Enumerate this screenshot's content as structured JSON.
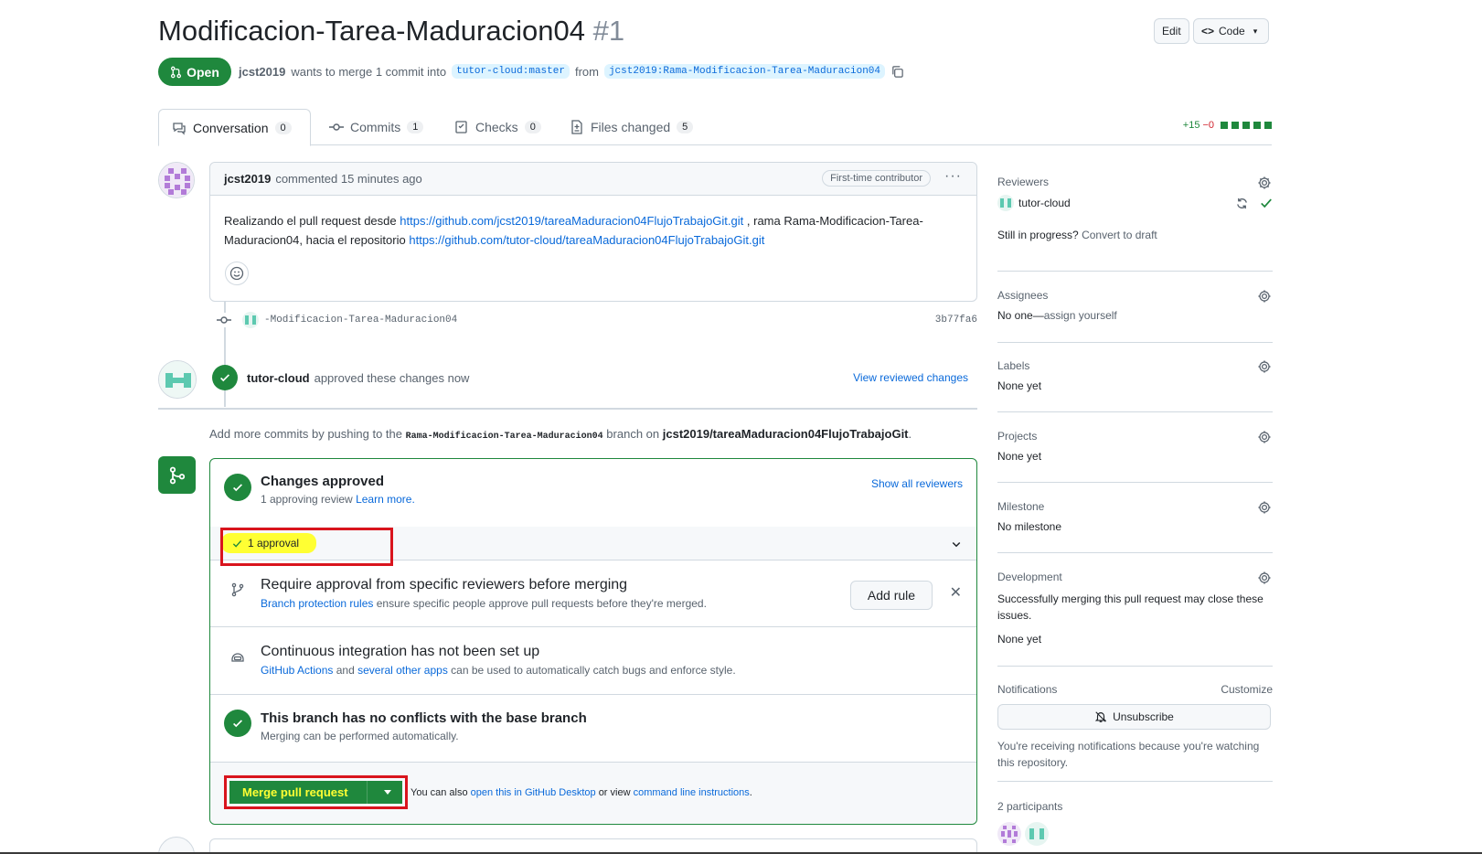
{
  "header": {
    "title": "Modificacion-Tarea-Maduracion04",
    "number": "#1",
    "edit_label": "Edit",
    "code_label": "Code",
    "status": "Open",
    "author": "jcst2019",
    "merge_text": "wants to merge 1 commit into",
    "base_branch": "tutor-cloud:master",
    "from_text": "from",
    "head_branch": "jcst2019:Rama-Modificacion-Tarea-Maduracion04"
  },
  "tabs": [
    {
      "label": "Conversation",
      "count": "0"
    },
    {
      "label": "Commits",
      "count": "1"
    },
    {
      "label": "Checks",
      "count": "0"
    },
    {
      "label": "Files changed",
      "count": "5"
    }
  ],
  "diffstat": {
    "additions": "+15",
    "deletions": "−0"
  },
  "comment": {
    "author": "jcst2019",
    "action": "commented 15 minutes ago",
    "badge": "First-time contributor",
    "body_1": "Realizando el pull request desde",
    "link_1": "https://github.com/jcst2019/tareaMaduracion04FlujoTrabajoGit.git",
    "body_2": ", rama Rama-Modificacion-Tarea-Maduracion04, hacia el repositorio",
    "link_2": "https://github.com/tutor-cloud/tareaMaduracion04FlujoTrabajoGit.git"
  },
  "commit": {
    "message": "-Modificacion-Tarea-Maduracion04",
    "sha": "3b77fa6"
  },
  "approval_event": {
    "user": "tutor-cloud",
    "text": "approved these changes now",
    "link": "View reviewed changes"
  },
  "add_commits": {
    "prefix": "Add more commits by pushing to the",
    "branch": "Rama-Modificacion-Tarea-Maduracion04",
    "middle": "branch on",
    "repo": "jcst2019/tareaMaduracion04FlujoTrabajoGit",
    "suffix": "."
  },
  "merge_box": {
    "approved_title": "Changes approved",
    "approved_sub": "1 approving review",
    "learn_more": "Learn more.",
    "show_reviewers": "Show all reviewers",
    "approval_count": "1 approval",
    "rule_title": "Require approval from specific reviewers before merging",
    "rule_link": "Branch protection rules",
    "rule_sub": "ensure specific people approve pull requests before they're merged.",
    "add_rule": "Add rule",
    "ci_title": "Continuous integration has not been set up",
    "ci_link_1": "GitHub Actions",
    "ci_and": "and",
    "ci_link_2": "several other apps",
    "ci_sub": "can be used to automatically catch bugs and enforce style.",
    "conflict_title": "This branch has no conflicts with the base branch",
    "conflict_sub": "Merging can be performed automatically.",
    "merge_button": "Merge pull request",
    "also_text": "You can also",
    "desktop_link": "open this in GitHub Desktop",
    "or_view": "or view",
    "cli_link": "command line instructions",
    "period": "."
  },
  "sidebar": {
    "reviewers_label": "Reviewers",
    "reviewer": "tutor-cloud",
    "draft_text": "Still in progress?",
    "draft_link": "Convert to draft",
    "assignees_label": "Assignees",
    "assignees_none": "No one—",
    "assign_link": "assign yourself",
    "labels_label": "Labels",
    "labels_val": "None yet",
    "projects_label": "Projects",
    "projects_val": "None yet",
    "milestone_label": "Milestone",
    "milestone_val": "No milestone",
    "development_label": "Development",
    "development_text": "Successfully merging this pull request may close these issues.",
    "development_val": "None yet",
    "notifications_label": "Notifications",
    "customize": "Customize",
    "unsubscribe": "Unsubscribe",
    "notif_text": "You're receiving notifications because you're watching this repository.",
    "participants": "2 participants"
  },
  "colors": {
    "green": "#1f883d",
    "link": "#0969da",
    "highlight": "#ffff33",
    "annotation_red": "#d9141d"
  }
}
